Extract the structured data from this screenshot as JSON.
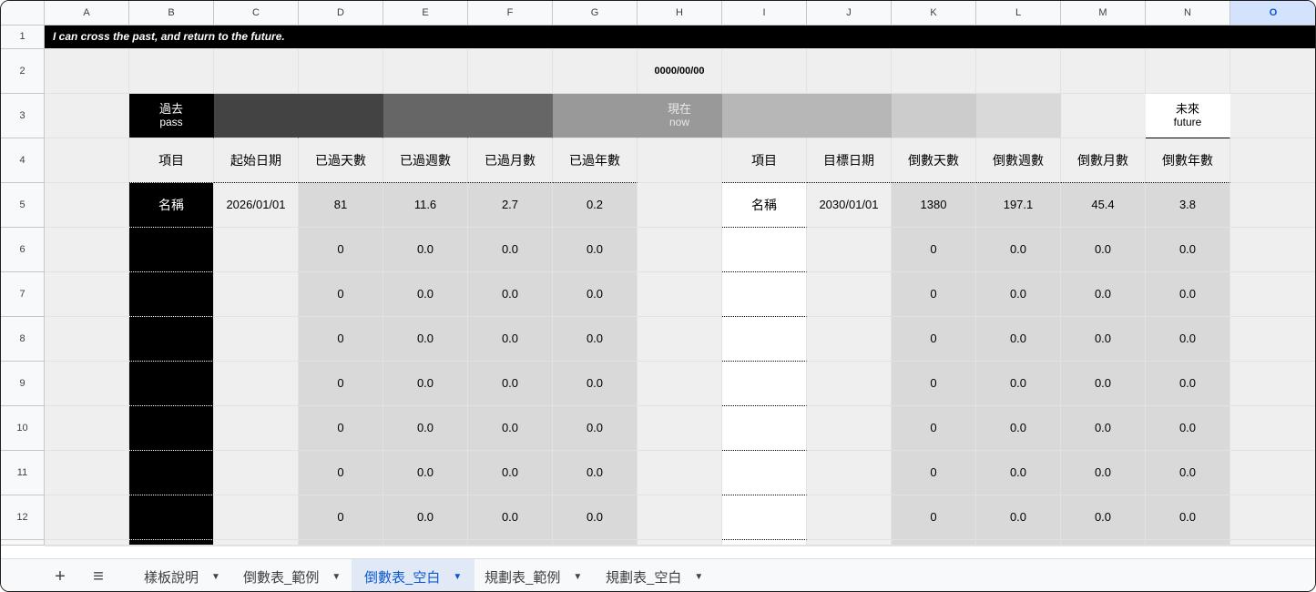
{
  "spreadsheet": {
    "column_letters": [
      "A",
      "B",
      "C",
      "D",
      "E",
      "F",
      "G",
      "H",
      "I",
      "J",
      "K",
      "L",
      "M",
      "N",
      "O"
    ],
    "selected_column": "O",
    "row_numbers": [
      "1",
      "2",
      "3",
      "4",
      "5",
      "6",
      "7",
      "8",
      "9",
      "10",
      "11",
      "12"
    ],
    "banner_text": "I can cross the past, and return to the future.",
    "today_date": "0000/00/00",
    "timeline": {
      "past_title": "過去",
      "past_sub": "pass",
      "now_title": "現在",
      "now_sub": "now",
      "future_title": "未來",
      "future_sub": "future"
    },
    "past_headers": [
      "項目",
      "起始日期",
      "已過天數",
      "已過週數",
      "已過月數",
      "已過年數"
    ],
    "future_headers": [
      "項目",
      "目標日期",
      "倒數天數",
      "倒數週數",
      "倒數月數",
      "倒數年數"
    ],
    "past_example": [
      "名稱",
      "2026/01/01",
      "81",
      "11.6",
      "2.7",
      "0.2"
    ],
    "future_example": [
      "名稱",
      "2030/01/01",
      "1380",
      "197.1",
      "45.4",
      "3.8"
    ],
    "blank_values": [
      "0",
      "0.0",
      "0.0",
      "0.0"
    ]
  },
  "sheet_tabs": {
    "add_label": "+",
    "menu_label": "≡",
    "tabs": [
      {
        "label": "樣板說明"
      },
      {
        "label": "倒數表_範例"
      },
      {
        "label": "倒數表_空白",
        "active": true
      },
      {
        "label": "規劃表_範例"
      },
      {
        "label": "規劃表_空白"
      }
    ]
  },
  "colors": {
    "banner_bg": "#000000",
    "value_gray": "#d9d9d9",
    "light_gray": "#efefef",
    "accent_blue": "#0b57d0"
  }
}
